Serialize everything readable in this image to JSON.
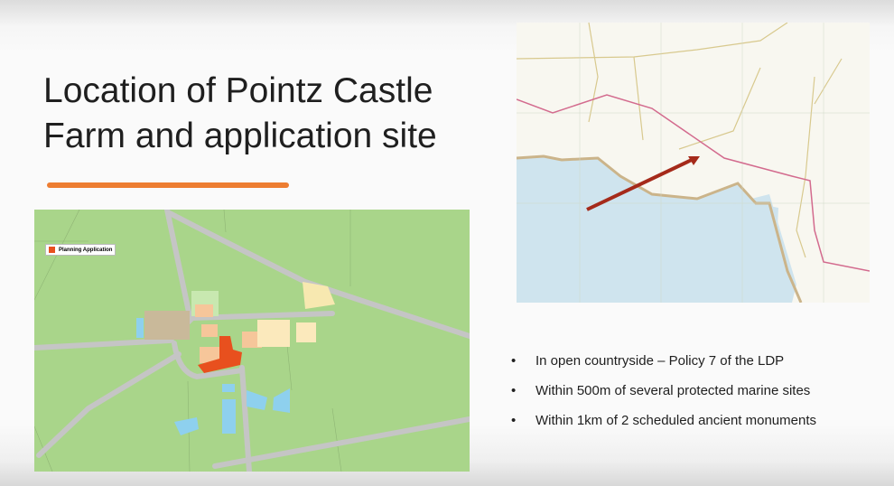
{
  "slide": {
    "title_lines": [
      "Location of Pointz Castle",
      "Farm and application site"
    ],
    "accent_color": "#ed7d31",
    "site_map": {
      "legend_label": "Planning Application",
      "legend_color": "#e8501e"
    },
    "location_map": {
      "arrow_color": "#a52a1a"
    },
    "bullets": [
      "In open countryside – Policy 7 of the LDP",
      "Within 500m of several protected marine sites",
      "Within 1km of 2 scheduled ancient monuments"
    ]
  }
}
